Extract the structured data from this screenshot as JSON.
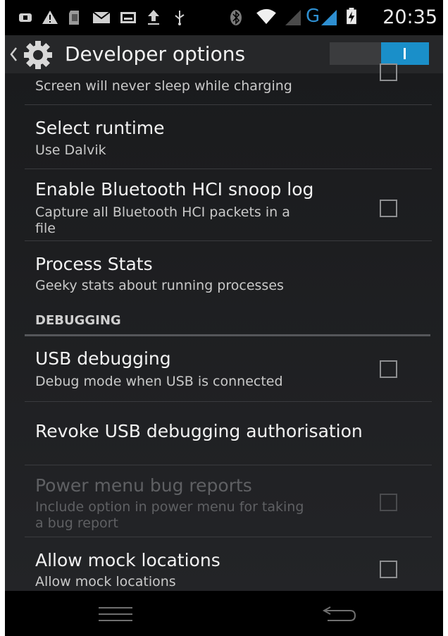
{
  "status_bar": {
    "time": "20:35",
    "left_icons": [
      "notification-icon",
      "warning-icon",
      "sd-card-icon",
      "mail-icon",
      "image-icon",
      "upload-icon",
      "usb-icon"
    ],
    "right_icons": [
      "bluetooth-icon",
      "wifi-icon",
      "signal-icon",
      "network-type-icon",
      "signal-icon",
      "battery-icon"
    ],
    "network_type": "G"
  },
  "action_bar": {
    "title": "Developer options",
    "toggle_on": true,
    "accent_color": "#1a8fc9"
  },
  "items": [
    {
      "subtitle": "Screen will never sleep while charging",
      "checked": false
    },
    {
      "title": "Select runtime",
      "subtitle": "Use Dalvik"
    },
    {
      "title": "Enable Bluetooth HCI snoop log",
      "subtitle_line1": "Capture all Bluetooth HCI packets in a",
      "subtitle_line2": "file",
      "checked": false
    },
    {
      "title": "Process Stats",
      "subtitle": "Geeky stats about running processes"
    }
  ],
  "debugging": {
    "header": "DEBUGGING",
    "items": [
      {
        "title": "USB debugging",
        "subtitle": "Debug mode when USB is connected",
        "checked": false
      },
      {
        "title": "Revoke USB debugging authorisation"
      },
      {
        "title": "Power menu bug reports",
        "subtitle_line1": "Include option in power menu for taking",
        "subtitle_line2": "a bug report",
        "checked": false,
        "disabled": true
      },
      {
        "title": "Allow mock locations",
        "subtitle": "Allow mock locations",
        "checked": false
      }
    ]
  },
  "nav_bar": {
    "icons": [
      "menu-icon",
      "back-icon"
    ]
  }
}
